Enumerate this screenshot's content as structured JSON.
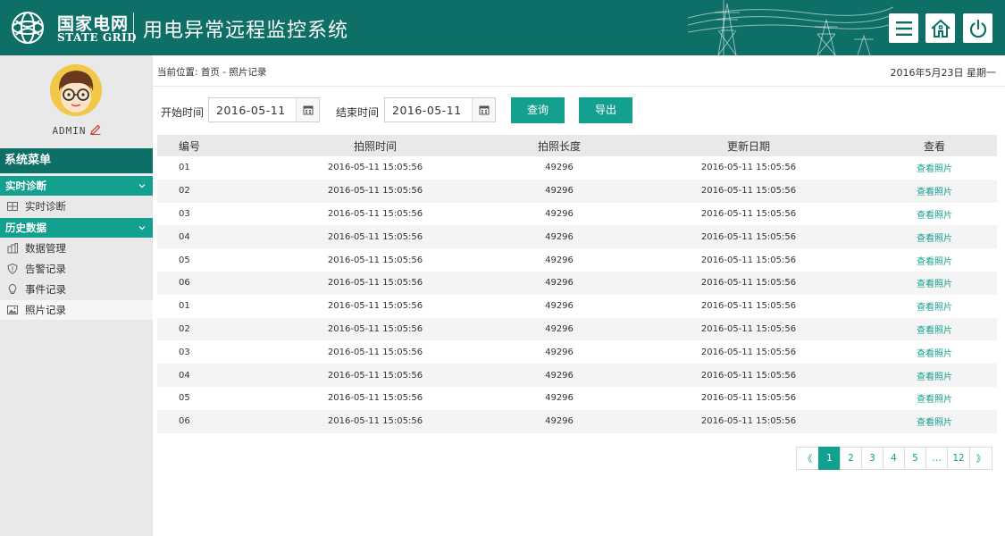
{
  "header": {
    "brand_cn": "国家电网",
    "brand_en": "STATE GRID",
    "system_title": "用电异常远程监控系统",
    "icons": [
      "menu-icon",
      "home-icon",
      "power-icon"
    ]
  },
  "colors": {
    "primary_dark": "#0e6f66",
    "primary": "#13a08f",
    "sidebar_bg": "#e9e9e9"
  },
  "user": {
    "name": "ADMIN"
  },
  "sidebar": {
    "menu_title": "系统菜单",
    "groups": [
      {
        "label": "实时诊断",
        "items": [
          {
            "label": "实时诊断",
            "icon": "diagnose-icon"
          }
        ]
      },
      {
        "label": "历史数据",
        "items": [
          {
            "label": "数据管理",
            "icon": "database-icon"
          },
          {
            "label": "告警记录",
            "icon": "alarm-shield-icon"
          },
          {
            "label": "事件记录",
            "icon": "lightbulb-icon"
          },
          {
            "label": "照片记录",
            "icon": "photo-icon",
            "active": true
          }
        ]
      }
    ]
  },
  "breadcrumb": {
    "text": "当前位置: 首页 - 照片记录"
  },
  "current_date": "2016年5月23日 星期一",
  "filters": {
    "start_label": "开始时间",
    "start_value": "2016-05-11",
    "end_label": "结束时间",
    "end_value": "2016-05-11",
    "query_button": "查询",
    "export_button": "导出"
  },
  "table": {
    "headers": [
      "编号",
      "拍照时间",
      "拍照长度",
      "更新日期",
      "查看"
    ],
    "rows": [
      [
        "01",
        "2016-05-11 15:05:56",
        "49296",
        "2016-05-11 15:05:56",
        "查看照片"
      ],
      [
        "02",
        "2016-05-11 15:05:56",
        "49296",
        "2016-05-11 15:05:56",
        "查看照片"
      ],
      [
        "03",
        "2016-05-11 15:05:56",
        "49296",
        "2016-05-11 15:05:56",
        "查看照片"
      ],
      [
        "04",
        "2016-05-11 15:05:56",
        "49296",
        "2016-05-11 15:05:56",
        "查看照片"
      ],
      [
        "05",
        "2016-05-11 15:05:56",
        "49296",
        "2016-05-11 15:05:56",
        "查看照片"
      ],
      [
        "06",
        "2016-05-11 15:05:56",
        "49296",
        "2016-05-11 15:05:56",
        "查看照片"
      ],
      [
        "01",
        "2016-05-11 15:05:56",
        "49296",
        "2016-05-11 15:05:56",
        "查看照片"
      ],
      [
        "02",
        "2016-05-11 15:05:56",
        "49296",
        "2016-05-11 15:05:56",
        "查看照片"
      ],
      [
        "03",
        "2016-05-11 15:05:56",
        "49296",
        "2016-05-11 15:05:56",
        "查看照片"
      ],
      [
        "04",
        "2016-05-11 15:05:56",
        "49296",
        "2016-05-11 15:05:56",
        "查看照片"
      ],
      [
        "05",
        "2016-05-11 15:05:56",
        "49296",
        "2016-05-11 15:05:56",
        "查看照片"
      ],
      [
        "06",
        "2016-05-11 15:05:56",
        "49296",
        "2016-05-11 15:05:56",
        "查看照片"
      ]
    ]
  },
  "pagination": {
    "prev": "《",
    "pages": [
      "1",
      "2",
      "3",
      "4",
      "5",
      "…",
      "12"
    ],
    "next": "》",
    "current": "1"
  }
}
